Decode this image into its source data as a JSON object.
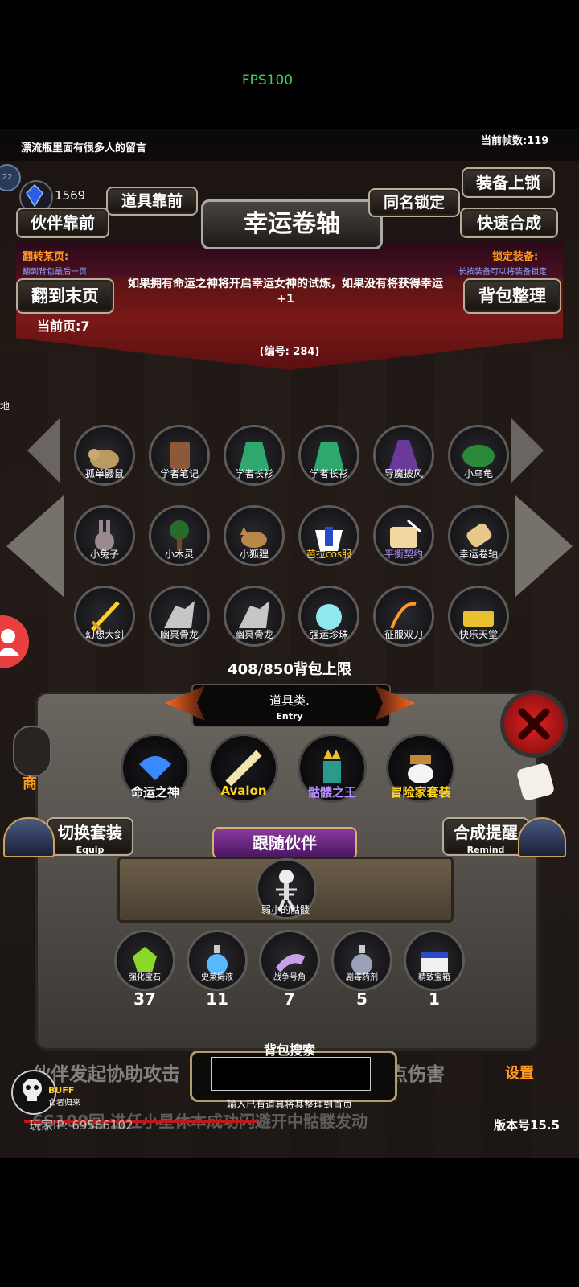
{
  "status": {
    "fps": "FPS100"
  },
  "header": {
    "message": "漂流瓶里面有很多人的留言",
    "frame_count": "当前帧数:119",
    "gem_count": "1569"
  },
  "top_buttons": {
    "item_front": "道具靠前",
    "same_name_lock": "同名锁定",
    "equip_lock": "装备上锁",
    "partner_front": "伙伴靠前",
    "quick_combine": "快速合成",
    "go_last_page": "翻到末页",
    "bag_sort": "背包整理"
  },
  "title": "幸运卷轴",
  "hints": {
    "flip_title": "翻转某页:",
    "flip_sub": "翻到背包最后一页",
    "lock_title": "锁定装备:",
    "lock_sub": "长按装备可以将装备锁定"
  },
  "item_desc": "如果拥有命运之神将开启幸运女神的试炼，如果没有将获得幸运+1",
  "item_id": "(编号: 284)",
  "current_page": "当前页:7",
  "grid_items": [
    {
      "label": "孤单鼹鼠",
      "color": "#ffffff",
      "icon": "mole-icon"
    },
    {
      "label": "学者笔记",
      "color": "#ffffff",
      "icon": "notebook-icon"
    },
    {
      "label": "学者长衫",
      "color": "#ffffff",
      "icon": "robe-icon"
    },
    {
      "label": "学者长衫",
      "color": "#ffffff",
      "icon": "robe-icon"
    },
    {
      "label": "导魔披风",
      "color": "#ffffff",
      "icon": "cloak-icon"
    },
    {
      "label": "小乌龟",
      "color": "#ffffff",
      "icon": "turtle-icon"
    },
    {
      "label": "小兔子",
      "color": "#ffffff",
      "icon": "rabbit-icon"
    },
    {
      "label": "小木灵",
      "color": "#ffffff",
      "icon": "tree-spirit-icon"
    },
    {
      "label": "小狐狸",
      "color": "#ffffff",
      "icon": "fox-icon"
    },
    {
      "label": "芭拉cos服",
      "color": "#ffd21f",
      "icon": "costume-icon"
    },
    {
      "label": "平衡契约",
      "color": "#b690ff",
      "icon": "contract-icon"
    },
    {
      "label": "幸运卷轴",
      "color": "#ffffff",
      "icon": "scroll-icon"
    },
    {
      "label": "幻想大剑",
      "color": "#ffffff",
      "icon": "sword-icon"
    },
    {
      "label": "幽冥骨龙",
      "color": "#ffffff",
      "icon": "bone-dragon-icon"
    },
    {
      "label": "幽冥骨龙",
      "color": "#ffffff",
      "icon": "bone-dragon-icon"
    },
    {
      "label": "强运珍珠",
      "color": "#ffffff",
      "icon": "pearl-icon"
    },
    {
      "label": "征服双刀",
      "color": "#ffffff",
      "icon": "twin-blades-icon"
    },
    {
      "label": "快乐天堂",
      "color": "#ffffff",
      "icon": "gold-book-icon"
    }
  ],
  "bag_capacity": "408/850背包上限",
  "category": {
    "label": "道具类.",
    "entry": "Entry"
  },
  "equipped": [
    {
      "label": "命运之神",
      "color": "#ffffff",
      "icon": "fate-god-icon"
    },
    {
      "label": "Avalon",
      "color": "#ffd21f",
      "icon": "avalon-icon"
    },
    {
      "label": "骷髅之王",
      "color": "#b690ff",
      "icon": "skeleton-king-icon"
    },
    {
      "label": "冒险家套装",
      "color": "#ffd21f",
      "icon": "adventurer-set-icon"
    }
  ],
  "switch_set": {
    "label": "切换套装",
    "sub": "Equip"
  },
  "combine_remind": {
    "label": "合成提醒",
    "sub": "Remind"
  },
  "follow_partner": {
    "title": "跟随伙伴",
    "name": "弱小的骷髅"
  },
  "consumables": [
    {
      "label": "强化宝石",
      "count": "37",
      "icon": "gem-icon"
    },
    {
      "label": "史莱姆液",
      "count": "11",
      "icon": "potion-icon"
    },
    {
      "label": "战争号角",
      "count": "7",
      "icon": "horn-icon"
    },
    {
      "label": "剧毒药剂",
      "count": "5",
      "icon": "poison-icon"
    },
    {
      "label": "精致宝箱",
      "count": "1",
      "icon": "chest-icon"
    }
  ],
  "bag_search": {
    "title": "背包搜索",
    "hint": "输入已有道具将其整理到首页",
    "value": ""
  },
  "side": {
    "shop": "商",
    "settings": "设置",
    "level": "22",
    "map_char": "地"
  },
  "bottom": {
    "scroll_text": "伙伴发起协助攻击",
    "scroll_text2": "点伤害",
    "ticker": "6S100回 进任小星休本成功闪避开中骷髅发动",
    "player_ip": "玩家IP:  69566102",
    "version": "版本号15.5",
    "buff": "BUFF",
    "buff_sub": "亡者归来"
  },
  "colors": {
    "banner": "#7a1818",
    "gold": "#ffd21f",
    "purple": "#b690ff",
    "hint_orange": "#ff9a1f",
    "hint_blue": "#8aa8ff",
    "close_red": "#d81c1c"
  }
}
